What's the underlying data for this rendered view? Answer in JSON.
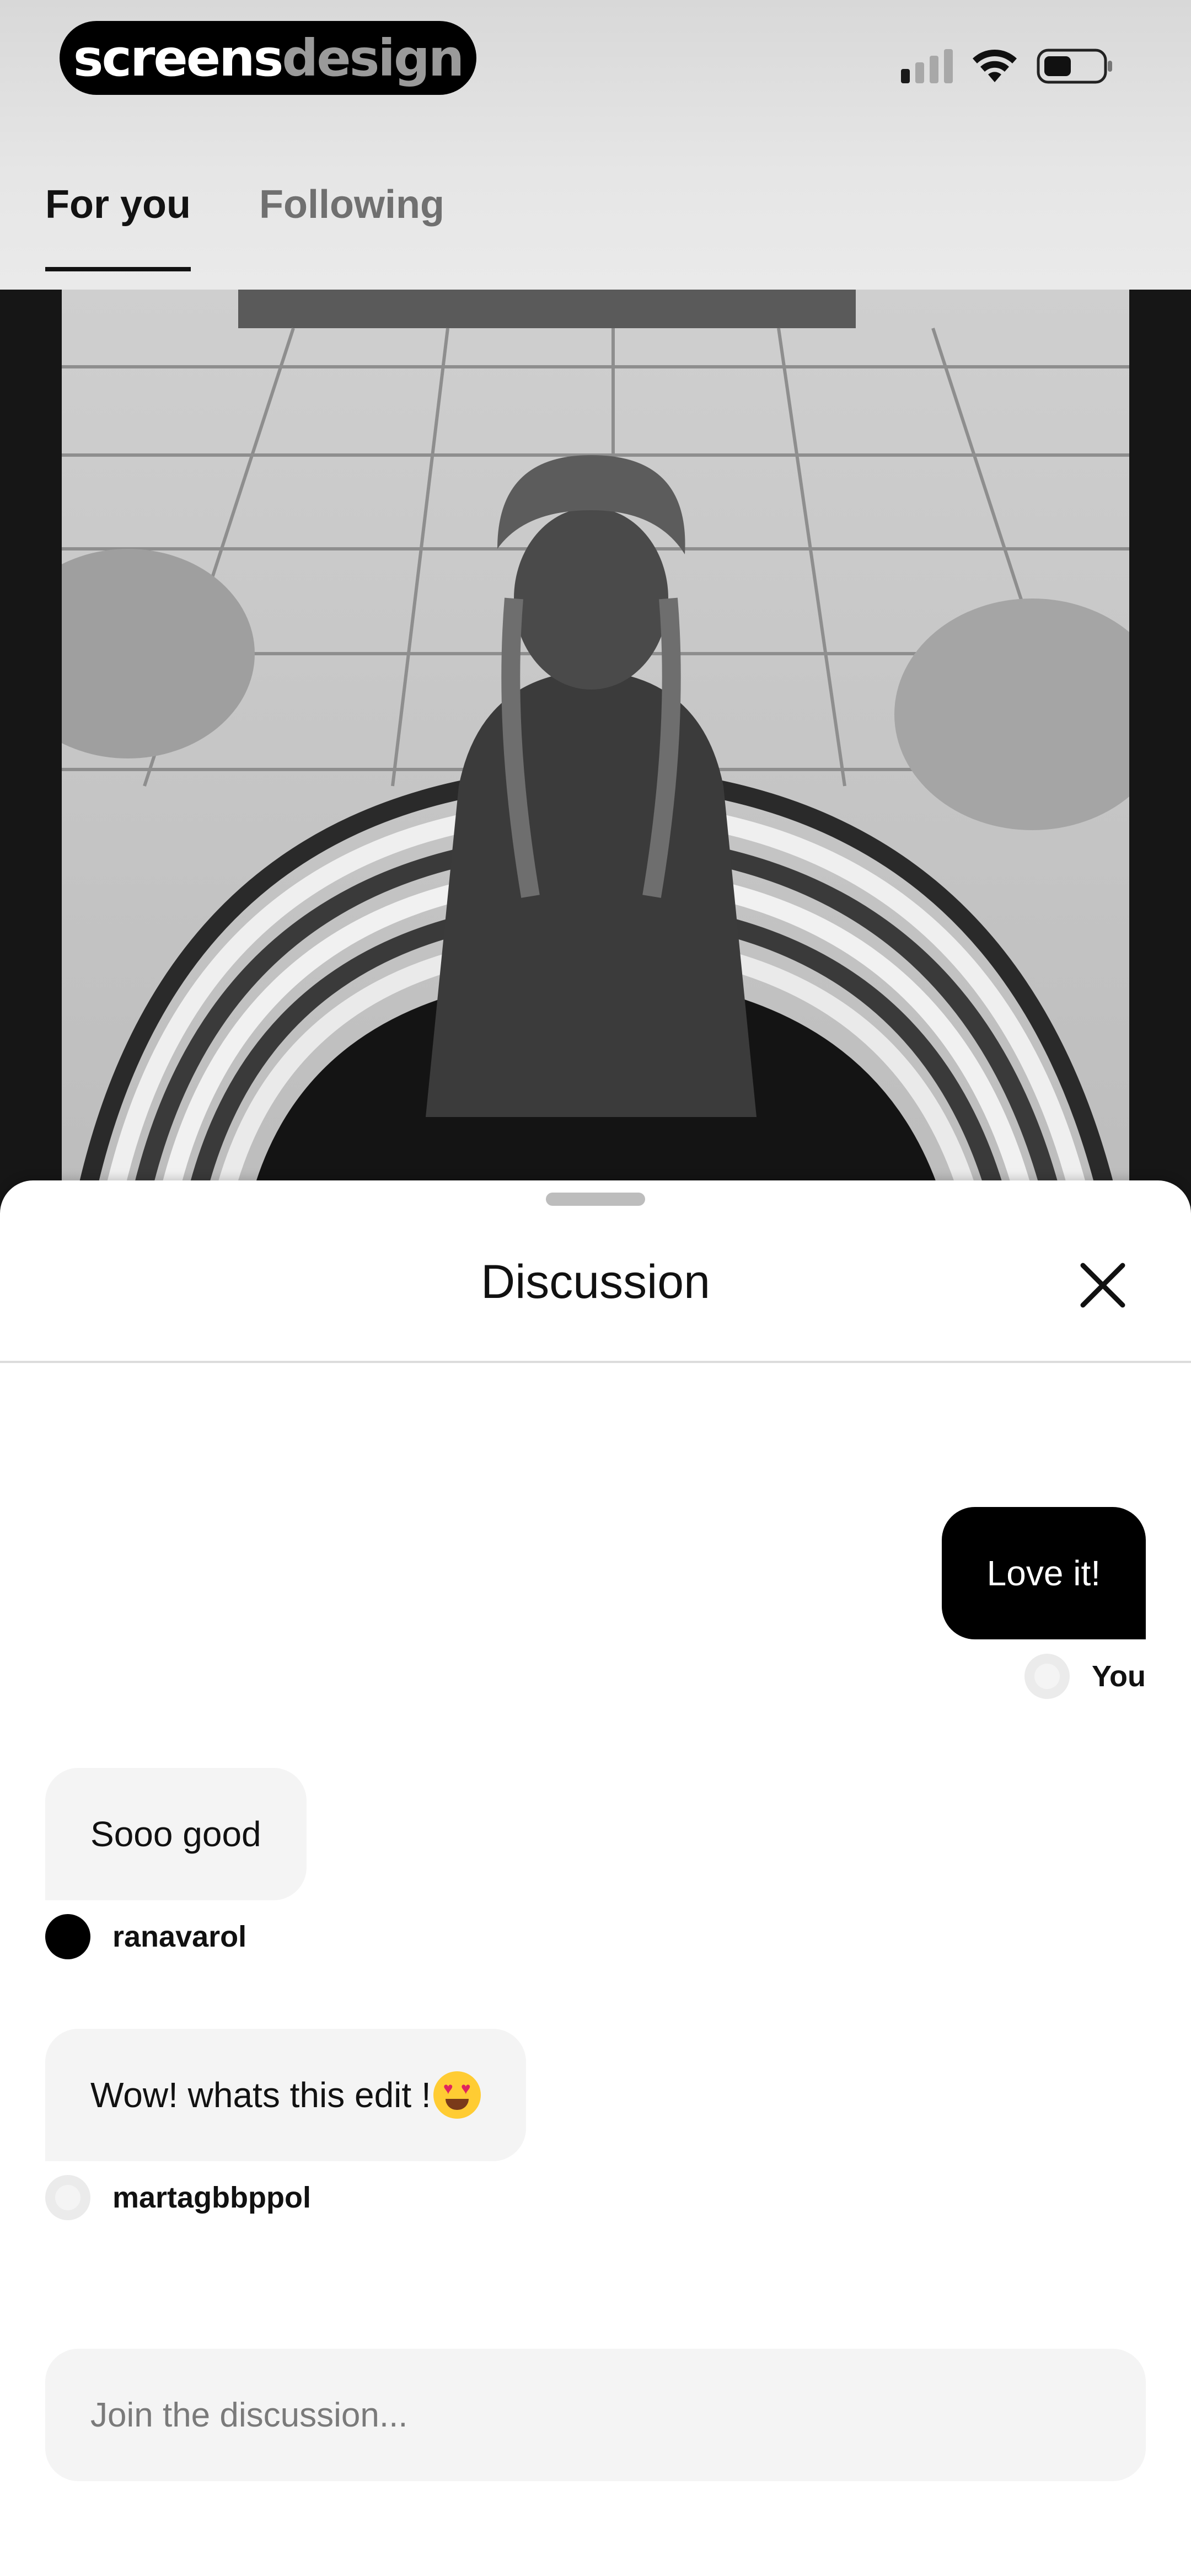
{
  "brand": {
    "part1": "screens",
    "part2": "design"
  },
  "status_bar": {
    "signal_icon": "cellular-signal-icon",
    "wifi_icon": "wifi-icon",
    "battery_icon": "battery-icon"
  },
  "tabs": [
    {
      "label": "For you",
      "active": true
    },
    {
      "label": "Following",
      "active": false
    }
  ],
  "discussion": {
    "title": "Discussion",
    "close_icon": "close-icon",
    "messages": [
      {
        "text": "Love it!",
        "author": "You",
        "mine": true
      },
      {
        "text": "Sooo good",
        "author": "ranavarol",
        "mine": false
      },
      {
        "text": "Wow! whats this edit !",
        "emoji": "heart-eyes-emoji",
        "author": "martagbbppol",
        "mine": false
      }
    ],
    "composer": {
      "placeholder": "Join the discussion..."
    }
  },
  "colors": {
    "accent": "#000000",
    "bubble_other": "#f4f4f4",
    "header_bg": "#e6e6e6"
  }
}
